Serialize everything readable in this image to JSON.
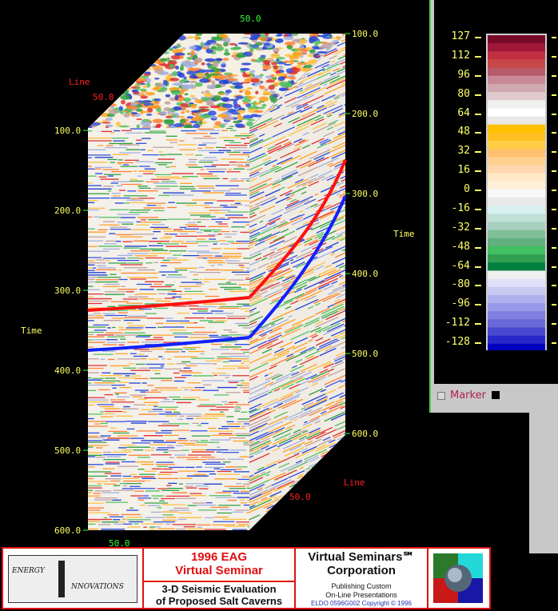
{
  "cube": {
    "top_line_label": "Line",
    "top_line_value": "50.0",
    "top_axis_value": "50.0",
    "right_axis_value": "50.0",
    "bottom_axis_value": "50.0",
    "right_line_label": "Line",
    "time_label_left": "Time",
    "time_label_right": "Time",
    "left_time_ticks": [
      "100.0",
      "200.0",
      "300.0",
      "400.0",
      "500.0",
      "600.0"
    ],
    "right_time_ticks": [
      "100.0",
      "200.0",
      "300.0",
      "400.0",
      "500.0",
      "600.0"
    ],
    "horizon_colors": {
      "upper": "#ff1010",
      "lower": "#1020ff"
    }
  },
  "colorbar": {
    "labels": [
      "127",
      "112",
      "96",
      "80",
      "64",
      "48",
      "32",
      "16",
      "0",
      "-16",
      "-32",
      "-48",
      "-64",
      "-80",
      "-96",
      "-112",
      "-128"
    ],
    "colors": [
      "#7a0a2a",
      "#a01838",
      "#c03040",
      "#c84848",
      "#b85a6a",
      "#c88898",
      "#d0a8b0",
      "#e0c8cc",
      "#f0f0f0",
      "#ffffff",
      "#e8e8e8",
      "#ffc000",
      "#ffc020",
      "#ffcc44",
      "#ffc070",
      "#ffd090",
      "#ffd8b0",
      "#ffe8c8",
      "#fff0d8",
      "#f8f8f8",
      "#e8e8e8",
      "#d8f0f0",
      "#c0e0d8",
      "#a8d0c0",
      "#80c098",
      "#60b080",
      "#40c060",
      "#30a050",
      "#008040",
      "#f0f0f0",
      "#e0e0f8",
      "#c8c8f0",
      "#b0b0f0",
      "#9898e8",
      "#8080e0",
      "#6868d8",
      "#4848d0",
      "#2828c8",
      "#0000c0"
    ],
    "marker_label": "Marker"
  },
  "banner": {
    "logo_line1": "ENERGY",
    "logo_line2": "NNOVATIONS",
    "seminar_line1": "1996 EAG",
    "seminar_line2": "Virtual Seminar",
    "topic_line1": "3-D Seismic Evaluation",
    "topic_line2": "of Proposed Salt Caverns",
    "corp_line1": "Virtual Seminars℠",
    "corp_line2": "Corporation",
    "corp_sub1": "Publishing Custom",
    "corp_sub2": "On-Line Presentations",
    "copyright": "ELDO 0596G002 Copyright © 1996"
  }
}
